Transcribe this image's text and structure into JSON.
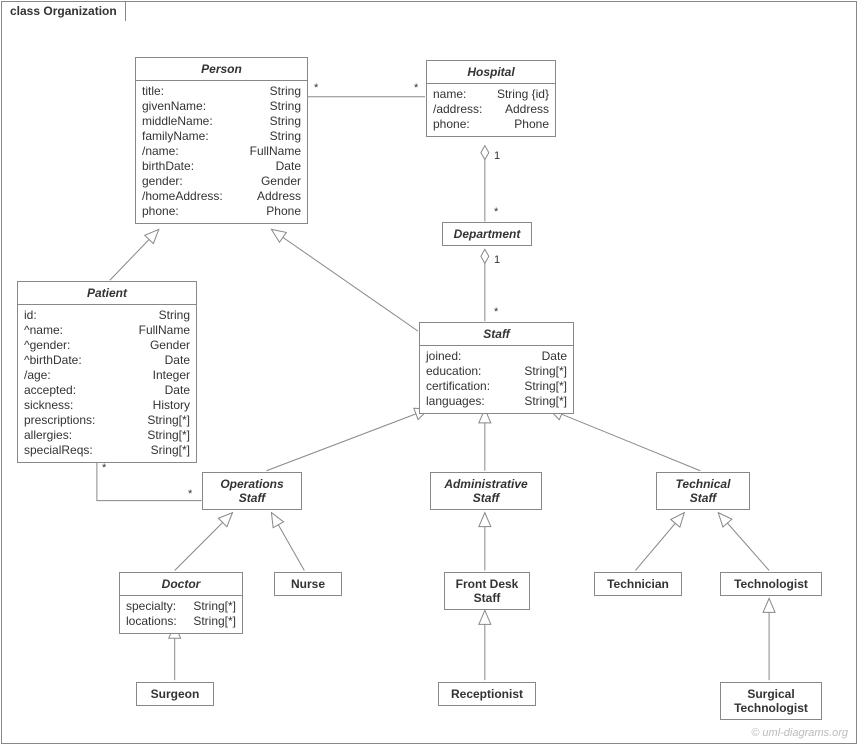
{
  "frameTitle": "class Organization",
  "watermark": "© uml-diagrams.org",
  "classes": {
    "person": {
      "name": "Person",
      "attrs": [
        [
          "title:",
          "String"
        ],
        [
          "givenName:",
          "String"
        ],
        [
          "middleName:",
          "String"
        ],
        [
          "familyName:",
          "String"
        ],
        [
          "/name:",
          "FullName"
        ],
        [
          "birthDate:",
          "Date"
        ],
        [
          "gender:",
          "Gender"
        ],
        [
          "/homeAddress:",
          "Address"
        ],
        [
          "phone:",
          "Phone"
        ]
      ]
    },
    "hospital": {
      "name": "Hospital",
      "attrs": [
        [
          "name:",
          "String {id}"
        ],
        [
          "/address:",
          "Address"
        ],
        [
          "phone:",
          "Phone"
        ]
      ]
    },
    "department": {
      "name": "Department"
    },
    "patient": {
      "name": "Patient",
      "attrs": [
        [
          "id:",
          "String"
        ],
        [
          "^name:",
          "FullName"
        ],
        [
          "^gender:",
          "Gender"
        ],
        [
          "^birthDate:",
          "Date"
        ],
        [
          "/age:",
          "Integer"
        ],
        [
          "accepted:",
          "Date"
        ],
        [
          "sickness:",
          "History"
        ],
        [
          "prescriptions:",
          "String[*]"
        ],
        [
          "allergies:",
          "String[*]"
        ],
        [
          "specialReqs:",
          "Sring[*]"
        ]
      ]
    },
    "staff": {
      "name": "Staff",
      "attrs": [
        [
          "joined:",
          "Date"
        ],
        [
          "education:",
          "String[*]"
        ],
        [
          "certification:",
          "String[*]"
        ],
        [
          "languages:",
          "String[*]"
        ]
      ]
    },
    "opsStaff": {
      "name": "Operations",
      "name2": "Staff"
    },
    "adminStaff": {
      "name": "Administrative",
      "name2": "Staff"
    },
    "techStaff": {
      "name": "Technical",
      "name2": "Staff"
    },
    "doctor": {
      "name": "Doctor",
      "attrs": [
        [
          "specialty:",
          "String[*]"
        ],
        [
          "locations:",
          "String[*]"
        ]
      ]
    },
    "nurse": {
      "name": "Nurse"
    },
    "frontDesk": {
      "name": "Front Desk",
      "name2": "Staff"
    },
    "technician": {
      "name": "Technician"
    },
    "technologist": {
      "name": "Technologist"
    },
    "surgeon": {
      "name": "Surgeon"
    },
    "receptionist": {
      "name": "Receptionist"
    },
    "surgTech": {
      "name": "Surgical",
      "name2": "Technologist"
    }
  },
  "mult": {
    "personHospL": "*",
    "personHospR": "*",
    "hospDept": "1",
    "deptParent": "*",
    "deptStaff": "1",
    "staffParent": "*",
    "patientOps": "*",
    "opsPatient": "*"
  }
}
